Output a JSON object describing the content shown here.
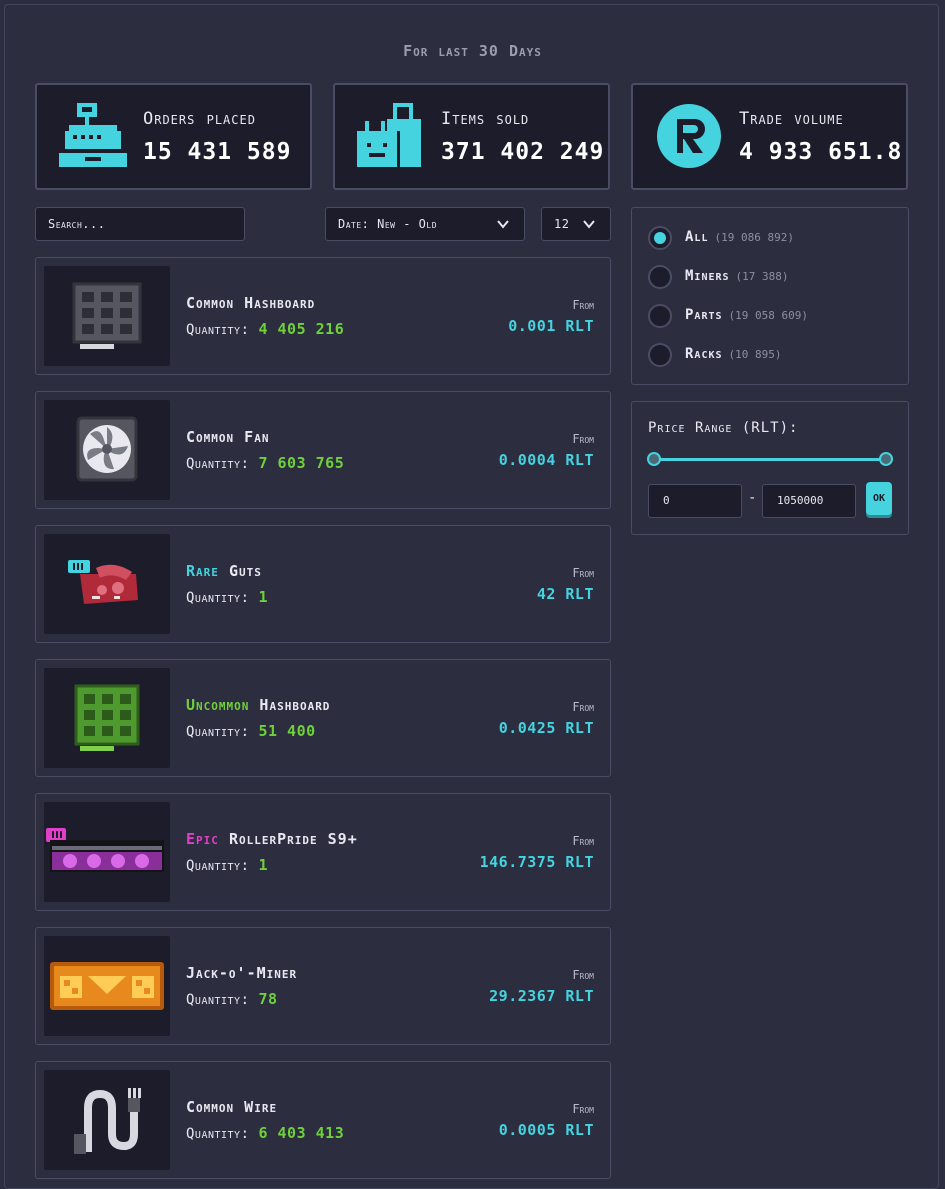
{
  "header": {
    "period": "For last 30 Days"
  },
  "stats": [
    {
      "label": "Orders placed",
      "value": "15 431 589",
      "icon": "cash-register-icon"
    },
    {
      "label": "Items sold",
      "value": "371 402 249",
      "icon": "shopping-bags-icon"
    },
    {
      "label": "Trade volume",
      "value": "4 933 651.8",
      "icon": "rlt-coin-icon"
    }
  ],
  "controls": {
    "search_placeholder": "Search...",
    "sort_value": "Date: New - Old",
    "per_page_value": "12"
  },
  "items": [
    {
      "rarity": "",
      "name": "Common Hashboard",
      "quantity_label": "Quantity:",
      "quantity": "4 405 216",
      "from_label": "From",
      "price": "0.001 RLT",
      "icon": "hashboard-icon"
    },
    {
      "rarity": "",
      "name": "Common Fan",
      "quantity_label": "Quantity:",
      "quantity": "7 603 765",
      "from_label": "From",
      "price": "0.0004 RLT",
      "icon": "fan-icon"
    },
    {
      "rarity": "Rare",
      "name": "Guts",
      "quantity_label": "Quantity:",
      "quantity": "1",
      "from_label": "From",
      "price": "42 RLT",
      "icon": "guts-icon"
    },
    {
      "rarity": "Uncommon",
      "name": "Hashboard",
      "quantity_label": "Quantity:",
      "quantity": "51 400",
      "from_label": "From",
      "price": "0.0425 RLT",
      "icon": "green-hashboard-icon"
    },
    {
      "rarity": "Epic",
      "name": "RollerPride S9+",
      "quantity_label": "Quantity:",
      "quantity": "1",
      "from_label": "From",
      "price": "146.7375 RLT",
      "icon": "miner-icon"
    },
    {
      "rarity": "",
      "name": "Jack-o'-Miner",
      "quantity_label": "Quantity:",
      "quantity": "78",
      "from_label": "From",
      "price": "29.2367 RLT",
      "icon": "pumpkin-miner-icon"
    },
    {
      "rarity": "",
      "name": "Common Wire",
      "quantity_label": "Quantity:",
      "quantity": "6 403 413",
      "from_label": "From",
      "price": "0.0005 RLT",
      "icon": "wire-icon"
    }
  ],
  "filters": {
    "categories": [
      {
        "label": "All",
        "count": "(19 086 892)",
        "selected": true
      },
      {
        "label": "Miners",
        "count": "(17 388)",
        "selected": false
      },
      {
        "label": "Parts",
        "count": "(19 058 609)",
        "selected": false
      },
      {
        "label": "Racks",
        "count": "(10 895)",
        "selected": false
      }
    ],
    "price_range": {
      "title": "Price Range (RLT):",
      "min": "0",
      "max": "1050000",
      "ok_label": "OK",
      "dash": "-"
    }
  },
  "colors": {
    "accent": "#45d3e0",
    "quantity": "#6fd13a",
    "rare": "#45d3e0",
    "uncommon": "#6fd13a",
    "epic": "#e040c8",
    "panel": "#1c1c2b",
    "background": "#2c2d3f"
  }
}
